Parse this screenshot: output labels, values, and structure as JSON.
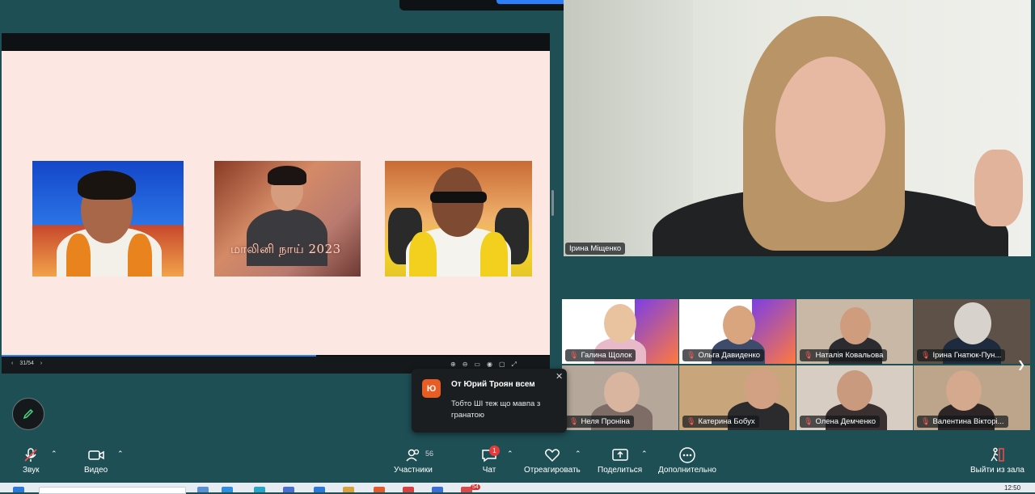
{
  "shared_screen": {
    "page_indicator": "31/54",
    "thumb2_caption": "மாலினி நாய் 2023"
  },
  "main_speaker": {
    "name": "Ірина Міщенко"
  },
  "participants_tiles": [
    {
      "name": "Галина Щолок",
      "muted": true
    },
    {
      "name": "Ольга Давиденко",
      "muted": true
    },
    {
      "name": "Наталія Ковальова",
      "muted": true
    },
    {
      "name": "Ірина Гнатюк-Пун...",
      "muted": true
    },
    {
      "name": "Неля Проніна",
      "muted": true
    },
    {
      "name": "Катерина Бобух",
      "muted": true
    },
    {
      "name": "Олена Демченко",
      "muted": true
    },
    {
      "name": "Валентина Вікторі...",
      "muted": true
    }
  ],
  "chat_popup": {
    "avatar_letter": "Ю",
    "title": "От Юрий Троян всем",
    "message": "Тобто ШІ теж що мавпа з гранатою"
  },
  "toolbar": {
    "audio_label": "Звук",
    "video_label": "Видео",
    "participants_label": "Участники",
    "participants_count": "56",
    "chat_label": "Чат",
    "chat_badge": "1",
    "react_label": "Отреагировать",
    "share_label": "Поделиться",
    "more_label": "Дополнительно",
    "leave_label": "Выйти из зала"
  },
  "taskbar": {
    "clock": "12:50",
    "badge": "54"
  },
  "colors": {
    "background": "#1e4f55",
    "slide_bg": "#fde7e3",
    "accent_blue": "#2d7ff9",
    "chat_avatar": "#e85d23",
    "badge_red": "#e63b3b"
  },
  "icons": [
    "mic-off-icon",
    "video-icon",
    "participants-icon",
    "chat-icon",
    "react-icon",
    "share-icon",
    "more-icon",
    "leave-icon",
    "pen-icon",
    "close-icon"
  ]
}
